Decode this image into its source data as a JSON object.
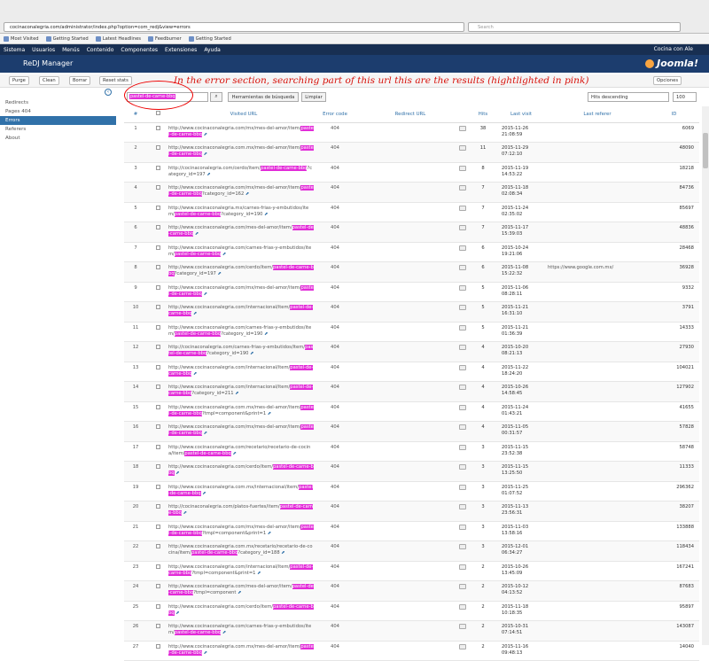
{
  "browser": {
    "url": "cocinaconalegria.com/administrator/index.php?option=com_redj&view=errors",
    "search_placeholder": "Search"
  },
  "bookmarks": [
    "Most Visited",
    "Getting Started",
    "Latest Headlines",
    "Feedburner",
    "Getting Started"
  ],
  "menu": {
    "items": [
      "Sistema",
      "Usuarios",
      "Menús",
      "Contenido",
      "Componentes",
      "Extensiones",
      "Ayuda"
    ],
    "site": "Cocina con Ale"
  },
  "header": {
    "title": "ReDJ Manager",
    "logo": "Joomla!"
  },
  "toolbar": {
    "purge": "Purge",
    "clean": "Clean",
    "delete": "Borrar",
    "reset": "Reset stats",
    "options": "Opciones"
  },
  "annotation": "In the error section, searching part of this url this are the results (hightlighted in pink)",
  "sidebar": {
    "items": [
      "Redirects",
      "Pages 404",
      "Errors",
      "Referers",
      "About"
    ]
  },
  "search": {
    "value": "pastel-de-carne-bbq",
    "tools": "Herramientas de búsqueda",
    "clear": "Limpiar",
    "sort": "Hits descending",
    "limit": "100"
  },
  "table": {
    "headers": {
      "url": "Visited URL",
      "code": "Error code",
      "redirect": "Redirect URL",
      "hits": "Hits",
      "last": "Last visit",
      "ref": "Last referer",
      "id": "ID"
    },
    "rows": [
      {
        "n": "1",
        "pre": "http://www.cocinaconalegria.com/mx/mes-del-amor/item/",
        "hl": "pastel-de-carne-bbq",
        "post": "",
        "code": "404",
        "hits": "38",
        "date": "2015-11-26",
        "time": "21:08:59",
        "ref": "",
        "id": "6069"
      },
      {
        "n": "2",
        "pre": "http://www.cocinaconalegria.com.mx/mes-del-amor/item/",
        "hl": "pastel-de-carne-bbq",
        "post": "",
        "code": "404",
        "hits": "11",
        "date": "2015-11-29",
        "time": "07:12:10",
        "ref": "",
        "id": "48090"
      },
      {
        "n": "3",
        "pre": "http://cocinaconalegria.com/cerdo/item/",
        "hl": "pastel-de-carne-bbq",
        "post": "?category_id=197",
        "code": "404",
        "hits": "8",
        "date": "2015-11-19",
        "time": "14:53:22",
        "ref": "",
        "id": "18218"
      },
      {
        "n": "4",
        "pre": "http://www.cocinaconalegria.com/mx/mes-del-amor/item/",
        "hl": "pastel-de-carne-bbq",
        "post": "?category_id=162",
        "code": "404",
        "hits": "7",
        "date": "2015-11-18",
        "time": "02:08:34",
        "ref": "",
        "id": "84736"
      },
      {
        "n": "5",
        "pre": "http://www.cocinaconalegria.mx/carnes-frias-y-embutidos/item/",
        "hl": "pastel-de-carne-bbq",
        "post": "?category_id=190",
        "code": "404",
        "hits": "7",
        "date": "2015-11-24",
        "time": "02:35:02",
        "ref": "",
        "id": "85697"
      },
      {
        "n": "6",
        "pre": "http://www.cocinaconalegria.com/mes-del-amor/item/",
        "hl": "pastel-de-carne-bbq",
        "post": "",
        "code": "404",
        "hits": "7",
        "date": "2015-11-17",
        "time": "15:39:03",
        "ref": "",
        "id": "48836"
      },
      {
        "n": "7",
        "pre": "http://www.cocinaconalegria.com/carnes-frias-y-embutidos/item/",
        "hl": "pastel-de-carne-bbq",
        "post": "",
        "code": "404",
        "hits": "6",
        "date": "2015-10-24",
        "time": "19:21:06",
        "ref": "",
        "id": "28468"
      },
      {
        "n": "8",
        "pre": "http://www.cocinaconalegria.com/cerdo/item/",
        "hl": "pastel-de-carne-bbq",
        "post": "?category_id=197",
        "code": "404",
        "hits": "6",
        "date": "2015-11-08",
        "time": "15:22:32",
        "ref": "https://www.google.com.mx/",
        "id": "36928"
      },
      {
        "n": "9",
        "pre": "http://www.cocinaconalegria.com/mx/mes-del-amor/item/",
        "hl": "pastel-de-carne-bbq",
        "post": "",
        "code": "404",
        "hits": "5",
        "date": "2015-11-06",
        "time": "08:28:11",
        "ref": "",
        "id": "9332"
      },
      {
        "n": "10",
        "pre": "http://www.cocinaconalegria.com/internacional/item/",
        "hl": "pastel-de-carne-bbq",
        "post": "",
        "code": "404",
        "hits": "5",
        "date": "2015-11-21",
        "time": "16:31:10",
        "ref": "",
        "id": "3791"
      },
      {
        "n": "11",
        "pre": "http://www.cocinaconalegria.com/carnes-frias-y-embutidos/item/",
        "hl": "pastel-de-carne-bbq",
        "post": "?category_id=190",
        "code": "404",
        "hits": "5",
        "date": "2015-11-21",
        "time": "01:36:39",
        "ref": "",
        "id": "14333"
      },
      {
        "n": "12",
        "pre": "http://cocinaconalegria.com/carnes-frias-y-embutidos/item/",
        "hl": "pastel-de-carne-bbq",
        "post": "?category_id=190",
        "code": "404",
        "hits": "4",
        "date": "2015-10-20",
        "time": "08:21:13",
        "ref": "",
        "id": "27930"
      },
      {
        "n": "13",
        "pre": "http://www.cocinaconalegria.com/internacional/item/",
        "hl": "pastel-de-carne-bbq",
        "post": "",
        "code": "404",
        "hits": "4",
        "date": "2015-11-22",
        "time": "18:24:20",
        "ref": "",
        "id": "104021"
      },
      {
        "n": "14",
        "pre": "http://www.cocinaconalegria.com/internacional/item/",
        "hl": "pastel-de-carne-bbq",
        "post": "?category_id=211",
        "code": "404",
        "hits": "4",
        "date": "2015-10-26",
        "time": "14:58:45",
        "ref": "",
        "id": "127902"
      },
      {
        "n": "15",
        "pre": "http://www.cocinaconalegria.com.mx/mes-del-amor/item/",
        "hl": "pastel-de-carne-bbq",
        "post": "?tmpl=component&print=1",
        "code": "404",
        "hits": "4",
        "date": "2015-11-24",
        "time": "01:43:21",
        "ref": "",
        "id": "41655"
      },
      {
        "n": "16",
        "pre": "http://www.cocinaconalegria.com/mx/mes-del-amor/item/",
        "hl": "pastel-de-carne-bbq",
        "post": "",
        "code": "404",
        "hits": "4",
        "date": "2015-11-05",
        "time": "00:31:57",
        "ref": "",
        "id": "57828"
      },
      {
        "n": "17",
        "pre": "http://www.cocinaconalegria.com/recetario/recetario-de-cocina/item/",
        "hl": "pastel-de-carne-bbq",
        "post": "",
        "code": "404",
        "hits": "3",
        "date": "2015-11-15",
        "time": "23:52:38",
        "ref": "",
        "id": "58748"
      },
      {
        "n": "18",
        "pre": "http://www.cocinaconalegria.com/cerdo/item/",
        "hl": "pastel-de-carne-bbq",
        "post": "",
        "code": "404",
        "hits": "3",
        "date": "2015-11-15",
        "time": "13:25:50",
        "ref": "",
        "id": "11333"
      },
      {
        "n": "19",
        "pre": "http://www.cocinaconalegria.com.mx/internacional/item/",
        "hl": "pastel-de-carne-bbq",
        "post": "",
        "code": "404",
        "hits": "3",
        "date": "2015-11-25",
        "time": "01:07:52",
        "ref": "",
        "id": "296362"
      },
      {
        "n": "20",
        "pre": "http://cocinaconalegria.com/platos-fuertes/item/",
        "hl": "pastel-de-carne-bbq",
        "post": "",
        "code": "404",
        "hits": "3",
        "date": "2015-11-13",
        "time": "23:56:31",
        "ref": "",
        "id": "38207"
      },
      {
        "n": "21",
        "pre": "http://www.cocinaconalegria.com/mx/mes-del-amor/item/",
        "hl": "pastel-de-carne-bbq",
        "post": "?tmpl=component&print=1",
        "code": "404",
        "hits": "3",
        "date": "2015-11-03",
        "time": "13:58:16",
        "ref": "",
        "id": "133888"
      },
      {
        "n": "22",
        "pre": "http://www.cocinaconalegria.com.mx/recetario/recetario-de-cocina/item/",
        "hl": "pastel-de-carne-bbq",
        "post": "?category_id=188",
        "code": "404",
        "hits": "3",
        "date": "2015-12-01",
        "time": "06:34:27",
        "ref": "",
        "id": "118434"
      },
      {
        "n": "23",
        "pre": "http://www.cocinaconalegria.com/internacional/item/",
        "hl": "pastel-de-carne-bbq",
        "post": "?tmpl=component&print=1",
        "code": "404",
        "hits": "2",
        "date": "2015-10-26",
        "time": "13:45:09",
        "ref": "",
        "id": "167241"
      },
      {
        "n": "24",
        "pre": "http://www.cocinaconalegria.com/mes-del-amor/item/",
        "hl": "pastel-de-carne-bbq",
        "post": "?tmpl=component",
        "code": "404",
        "hits": "2",
        "date": "2015-10-12",
        "time": "04:13:52",
        "ref": "",
        "id": "87683"
      },
      {
        "n": "25",
        "pre": "http://www.cocinaconalegria.com/cerdo/item/",
        "hl": "pastel-de-carne-bbq",
        "post": "",
        "code": "404",
        "hits": "2",
        "date": "2015-11-18",
        "time": "10:18:35",
        "ref": "",
        "id": "95897"
      },
      {
        "n": "26",
        "pre": "http://www.cocinaconalegria.com/carnes-frias-y-embutidos/item/",
        "hl": "pastel-de-carne-bbq",
        "post": "",
        "code": "404",
        "hits": "2",
        "date": "2015-10-31",
        "time": "07:14:51",
        "ref": "",
        "id": "143087"
      },
      {
        "n": "27",
        "pre": "http://www.cocinaconalegria.com.mx/mes-del-amor/item/",
        "hl": "pastel-de-carne-bbq",
        "post": "",
        "code": "404",
        "hits": "2",
        "date": "2015-11-16",
        "time": "09:48:13",
        "ref": "",
        "id": "14040"
      }
    ]
  }
}
